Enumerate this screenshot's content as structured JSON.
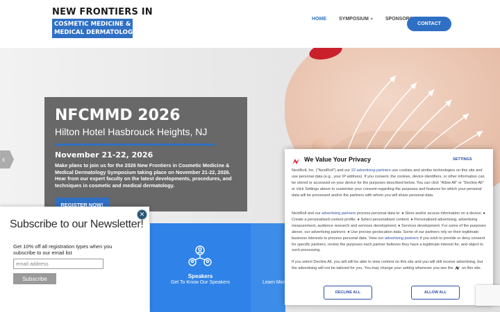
{
  "header": {
    "logo_line1": "NEW FRONTIERS IN",
    "logo_line2": "COSMETIC MEDICINE &",
    "logo_line3": "MEDICAL DERMATOLOGY",
    "nav": [
      {
        "label": "HOME",
        "active": true
      },
      {
        "label": "SYMPOSIUM",
        "caret": "▾"
      },
      {
        "label": "SPONSORS",
        "caret": "▾"
      }
    ],
    "contact_label": "CONTACT"
  },
  "hero": {
    "title": "NFCMMD 2026",
    "subtitle": "Hilton Hotel Hasbrouck Heights, NJ",
    "date": "November 21-22, 2026",
    "description": "Make plans to join us for the 2026 New Frontiers in Cosmetic Medicine & Medical Dermatology Symposium taking place on November 21-22, 2026. Hear from our expert faculty on the latest developments, procedures, and techniques in cosmetic and medical dermatology.",
    "register_label": "REGISTER NOW!",
    "prev_arrow": "‹"
  },
  "tiles": [
    {
      "title": "Speakers",
      "subtitle": "Get To Know Our Speakers",
      "icon": "people-network-icon"
    },
    {
      "subtitle": "Learn Mor"
    }
  ],
  "newsletter": {
    "title": "Subscribe to our Newsletter!",
    "close": "✕",
    "description": "Get 10% off all registration types when you subscribe to our email list",
    "placeholder": "email address",
    "button_label": "Subscribe"
  },
  "privacy": {
    "title": "We Value Your Privacy",
    "settings_label": "SETTINGS",
    "para1_a": "NextRoll, Inc. (\"NextRoll\") and our ",
    "para1_link": "22 advertising partners",
    "para1_b": " use cookies and similar technologies on this site and use personal data (e.g., your IP address). If you consent, the cookies, device identifiers, or other information can be stored or accessed on your device for the purposes described below. You can click \"Allow All\" or \"Decline All\" or click Settings above to customise your consent regarding the purposes and features for which your personal data will be processed and/or the partners with whom you will share personal data.",
    "para2_a": "NextRoll and our ",
    "para2_link1": "advertising partners",
    "para2_b": " process personal data to: ● Store and/or access information on a device; ● Create a personalised content profile; ● Select personalised content; ● Personalised advertising, advertising measurement, audience research and services development; ● Services development. For some of the purposes above, our advertising partners: ● Use precise geolocation data. Some of our partners rely on their legitimate business interests to process personal data. View our ",
    "para2_link2": "advertising partners",
    "para2_c": " if you wish to provide or deny consent for specific partners, review the purposes each partner believes they have a legitimate interest for, and object to such processing.",
    "para3_a": "If you select Decline All, you will still be able to view content on this site and you will still receive advertising, but the advertising will not be tailored for you. You may change your setting whenever you see the ",
    "para3_b": " on this site.",
    "decline_label": "DECLINE ALL",
    "allow_label": "ALLOW ALL",
    "accent_color": "#2f4ea3"
  }
}
